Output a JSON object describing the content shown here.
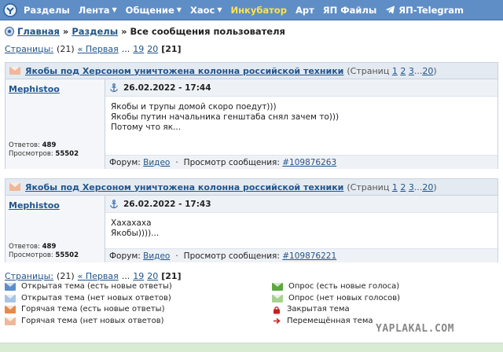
{
  "nav": {
    "logo_icon": "yaplakal-logo-icon",
    "items": [
      {
        "label": "Разделы",
        "dropdown": false
      },
      {
        "label": "Лента",
        "dropdown": true
      },
      {
        "label": "Общение",
        "dropdown": true
      },
      {
        "label": "Хаос",
        "dropdown": true
      },
      {
        "label": "Инкубатор",
        "dropdown": false,
        "accent": "#ffe34a"
      },
      {
        "label": "Арт",
        "dropdown": false
      },
      {
        "label": "ЯП Файлы",
        "dropdown": false
      },
      {
        "label": "ЯП-Telegram",
        "dropdown": false,
        "icon": "telegram-icon"
      }
    ],
    "bg_color": "#5f8ec6"
  },
  "breadcrumb": {
    "home": "Главная",
    "sep": "»",
    "section": "Разделы",
    "current": "Все сообщения пользователя"
  },
  "pager": {
    "label": "Страницы:",
    "total": "(21)",
    "first": "« Первая",
    "ellipsis": "...",
    "p19": "19",
    "p20": "20",
    "current": "[21]"
  },
  "posts": [
    {
      "title": "Якобы под Херсоном уничтожена колонна российской техники",
      "pages_label": "(Страниц",
      "pages_1": "1",
      "pages_2": "2",
      "pages_3": "3",
      "pages_ellipsis": "...",
      "pages_last": "20",
      "pages_close": ")",
      "author": "Mephistoo",
      "replies_label": "Ответов:",
      "replies": "489",
      "views_label": "Просмотров:",
      "views": "55502",
      "date": "26.02.2022 - 17:44",
      "lines": [
        "Якобы и трупы домой скоро поедут)))",
        "",
        "Якобы путин начальника генштаба снял зачем то)))",
        "",
        "Потому что як..."
      ],
      "forum_label": "Форум:",
      "forum": "Видео",
      "view_label": "Просмотр сообщения:",
      "msg_id": "#109876263"
    },
    {
      "title": "Якобы под Херсоном уничтожена колонна российской техники",
      "pages_label": "(Страниц",
      "pages_1": "1",
      "pages_2": "2",
      "pages_3": "3",
      "pages_ellipsis": "...",
      "pages_last": "20",
      "pages_close": ")",
      "author": "Mephistoo",
      "replies_label": "Ответов:",
      "replies": "489",
      "views_label": "Просмотров:",
      "views": "55502",
      "date": "26.02.2022 - 17:43",
      "lines": [
        "Хахахаха",
        "Якобы))))..."
      ],
      "forum_label": "Форум:",
      "forum": "Видео",
      "view_label": "Просмотр сообщения:",
      "msg_id": "#109876221"
    }
  ],
  "legend": {
    "left": [
      {
        "label": "Открытая тема (есть новые ответы)",
        "icon": "envelope-blue-icon",
        "color": "#5d8fc9"
      },
      {
        "label": "Открытая тема (нет новых ответов)",
        "icon": "envelope-lightblue-icon",
        "color": "#a9c4e4"
      },
      {
        "label": "Горячая тема (есть новые ответы)",
        "icon": "envelope-orange-icon",
        "color": "#e58a4a"
      },
      {
        "label": "Горячая тема (нет новых ответов)",
        "icon": "envelope-peach-icon",
        "color": "#f0b79a"
      }
    ],
    "right": [
      {
        "label": "Опрос (есть новые голоса)",
        "icon": "envelope-green-icon",
        "color": "#5aa83e"
      },
      {
        "label": "Опрос (нет новых голосов)",
        "icon": "envelope-lightgreen-icon",
        "color": "#a7d18f"
      },
      {
        "label": "Закрытая тема",
        "icon": "lock-icon",
        "color": "#c62020"
      },
      {
        "label": "Перемещённая тема",
        "icon": "move-arrow-icon",
        "color": "#c62020"
      }
    ]
  },
  "watermark": "YAPLAKAL.COM",
  "topic_icon_color": "#f0b79a"
}
